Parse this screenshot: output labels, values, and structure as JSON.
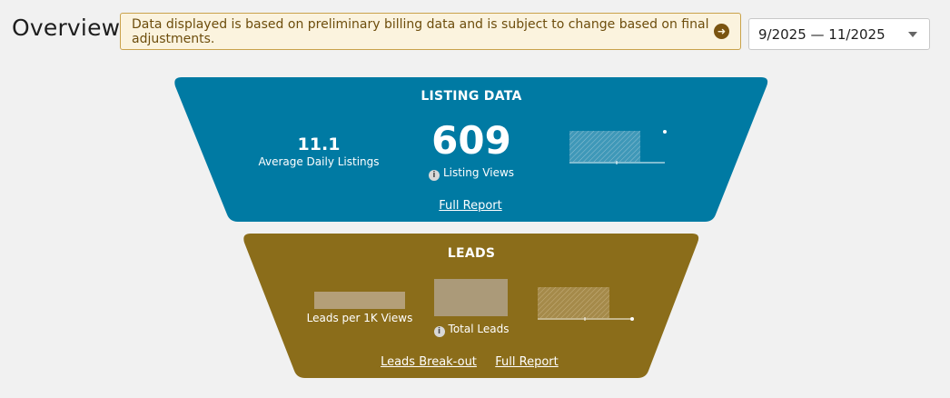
{
  "header": {
    "title": "Overview",
    "notice": "Data displayed is based on preliminary billing data and is subject to change based on final adjustments.",
    "date_range": "9/2025 — 11/2025"
  },
  "listing": {
    "title": "LISTING DATA",
    "avg_daily_value": "11.1",
    "avg_daily_label": "Average Daily Listings",
    "views_value": "609",
    "views_label": "Listing Views",
    "full_report": "Full Report"
  },
  "leads": {
    "title": "LEADS",
    "per_1k_label": "Leads per 1K Views",
    "total_label": "Total Leads",
    "breakout_link": "Leads Break-out",
    "full_report": "Full Report"
  },
  "colors": {
    "listing": "#007aa3",
    "leads": "#8b6d1a",
    "notice_bg": "#fbf3de"
  }
}
